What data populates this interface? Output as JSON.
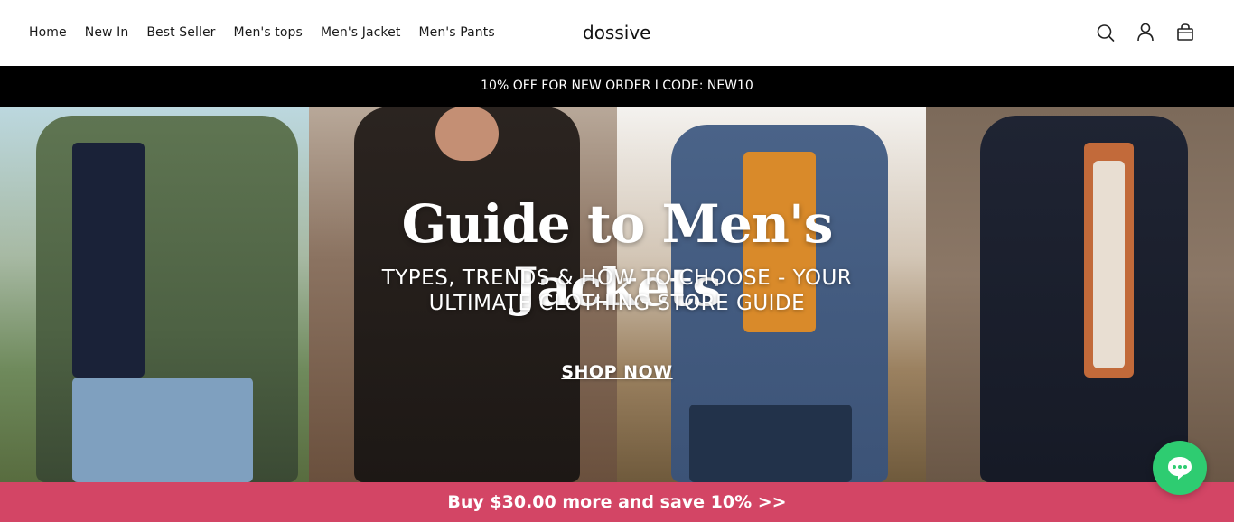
{
  "nav": {
    "items": [
      {
        "label": "Home"
      },
      {
        "label": "New In"
      },
      {
        "label": "Best Seller"
      },
      {
        "label": "Men's tops"
      },
      {
        "label": "Men's Jacket"
      },
      {
        "label": "Men's Pants"
      }
    ]
  },
  "logo": "dossive",
  "header_icons": [
    "search-icon",
    "user-icon",
    "cart-icon"
  ],
  "promo": "10% OFF FOR NEW ORDER I CODE: NEW10",
  "hero": {
    "title": "Guide to Men's Jackets",
    "subtitle_line1": "TYPES, TRENDS & HOW TO CHOOSE - YOUR",
    "subtitle_line2": "ULTIMATE CLOTHING STORE GUIDE",
    "cta": "SHOP NOW"
  },
  "bottom_bar": "Buy $30.00 more and save 10%  >>",
  "colors": {
    "bottom_bar": "#d34565",
    "chat_button": "#2ecc71",
    "promo_bar": "#000000"
  }
}
